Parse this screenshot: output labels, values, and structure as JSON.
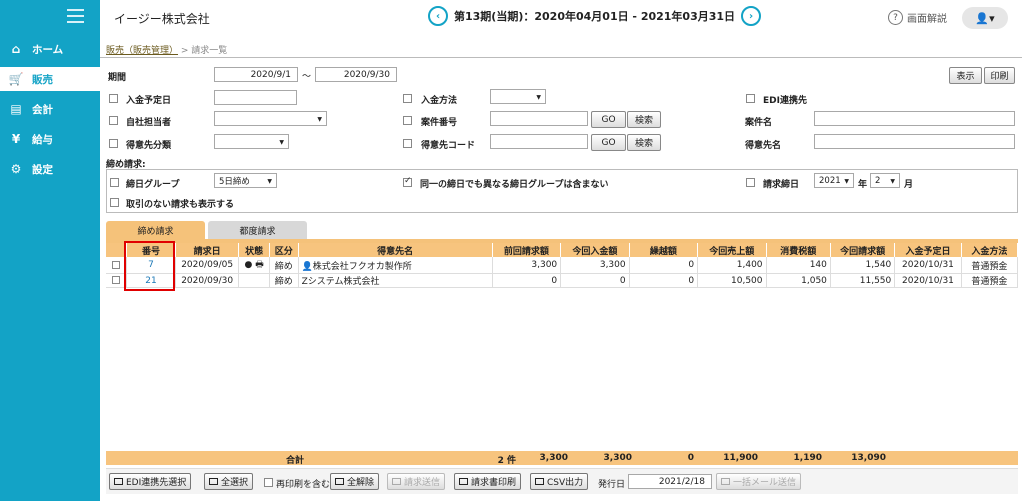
{
  "colors": {
    "accent": "#13a3c6",
    "header_bg": "#f7c47e",
    "highlight": "#e00000"
  },
  "nav": [
    {
      "label": "ホーム",
      "icon": "home-icon"
    },
    {
      "label": "販売",
      "icon": "cart-icon"
    },
    {
      "label": "会計",
      "icon": "ledger-icon"
    },
    {
      "label": "給与",
      "icon": "money-bag-icon"
    },
    {
      "label": "設定",
      "icon": "gear-icon"
    }
  ],
  "header": {
    "company": "イージー株式会社",
    "period": "第13期(当期)：2020年04月01日 - 2021年03月31日",
    "help": "画面解説",
    "prev": "‹",
    "next": "›",
    "user": "▾"
  },
  "breadcrumb": {
    "link": "販売（販売管理）",
    "current": "> 請求一覧"
  },
  "filters": {
    "period_label": "期間",
    "period_from": "2020/9/1",
    "tilde": "〜",
    "period_to": "2020/9/30",
    "show_btn": "表示",
    "print_btn": "印刷",
    "payment_date": "入金予定日",
    "payment_method": "入金方法",
    "edi": "EDI連携先",
    "staff": "自社担当者",
    "case_no": "案件番号",
    "case_name": "案件名",
    "cust_class": "得意先分類",
    "cust_code": "得意先コード",
    "cust_name": "得意先名",
    "go": "GO",
    "search": "検索",
    "closing_label": "締め請求:",
    "closing_group": "締日グループ",
    "closing_group_value": "5日締め",
    "exclude_other": "同一の締日でも異なる締日グループは含まない",
    "bill_date": "請求締日",
    "year": "2021",
    "year_unit": "年",
    "month": "2",
    "month_unit": "月",
    "show_no_tx": "取引のない請求も表示する"
  },
  "tabs": {
    "closing": "締め請求",
    "each": "都度請求"
  },
  "columns": [
    "番号",
    "請求日",
    "状態",
    "区分",
    "得意先名",
    "前回請求額",
    "今回入金額",
    "繰越額",
    "今回売上額",
    "消費税額",
    "今回請求額",
    "入金予定日",
    "入金方法"
  ],
  "rows": [
    {
      "id": "7",
      "date": "2020/09/05",
      "status": "● 🖶",
      "kind": "締め",
      "customer": "👤株式会社フクオカ製作所",
      "prev": "3,300",
      "paid": "3,300",
      "carry": "0",
      "sales": "1,400",
      "tax": "140",
      "bill": "1,540",
      "due": "2020/10/31",
      "method": "普通預金"
    },
    {
      "id": "21",
      "date": "2020/09/30",
      "status": "",
      "kind": "締め",
      "customer": "Zシステム株式会社",
      "prev": "0",
      "paid": "0",
      "carry": "0",
      "sales": "10,500",
      "tax": "1,050",
      "bill": "11,550",
      "due": "2020/10/31",
      "method": "普通預金"
    }
  ],
  "totals": {
    "label": "合計",
    "count": "2 件",
    "prev": "3,300",
    "paid": "3,300",
    "carry": "0",
    "sales": "11,900",
    "tax": "1,190",
    "bill": "13,090"
  },
  "footer": {
    "edi_select": "EDI連携先選択",
    "select_all": "全選択",
    "reprint": "再印刷を含む",
    "clear_all": "全解除",
    "send_bill": "請求送信",
    "print_bill": "請求書印刷",
    "csv": "CSV出力",
    "issue_label": "発行日",
    "issue_date": "2021/2/18",
    "bulk_mail": "一括メール送信"
  }
}
